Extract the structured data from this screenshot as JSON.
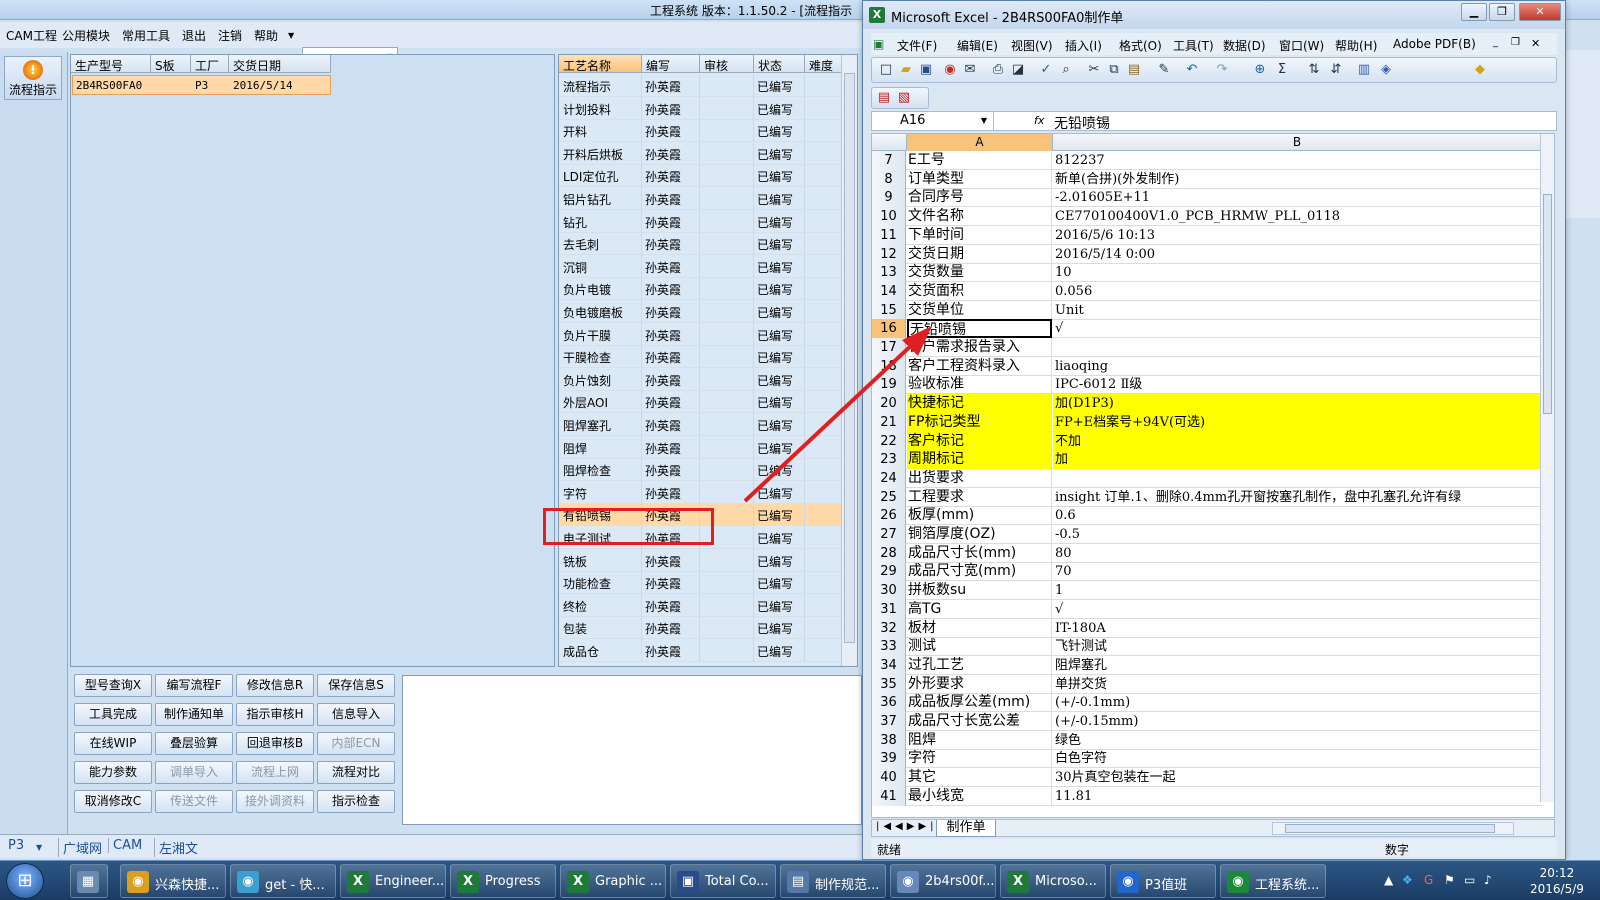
{
  "app": {
    "title": "工程系统   版本：1.1.50.2 - [流程指示",
    "menu": [
      "CAM工程",
      "公用模块",
      "常用工具",
      "退出",
      "注销",
      "帮助"
    ],
    "flow_button": "流程指示",
    "model_table": {
      "headers": [
        "生产型号",
        "S板",
        "工厂",
        "交货日期"
      ],
      "row": [
        "2B4RS00FA0",
        "",
        "P3",
        "2016/5/14"
      ]
    },
    "process_table": {
      "headers": [
        "工艺名称",
        "编写",
        "审核",
        "状态",
        "难度"
      ],
      "rows": [
        [
          "流程指示",
          "孙英霞",
          "",
          "已编写"
        ],
        [
          "计划投料",
          "孙英霞",
          "",
          "已编写"
        ],
        [
          "开料",
          "孙英霞",
          "",
          "已编写"
        ],
        [
          "开料后烘板",
          "孙英霞",
          "",
          "已编写"
        ],
        [
          "LDI定位孔",
          "孙英霞",
          "",
          "已编写"
        ],
        [
          "铝片钻孔",
          "孙英霞",
          "",
          "已编写"
        ],
        [
          "钻孔",
          "孙英霞",
          "",
          "已编写"
        ],
        [
          "去毛刺",
          "孙英霞",
          "",
          "已编写"
        ],
        [
          "沉铜",
          "孙英霞",
          "",
          "已编写"
        ],
        [
          "负片电镀",
          "孙英霞",
          "",
          "已编写"
        ],
        [
          "负电镀磨板",
          "孙英霞",
          "",
          "已编写"
        ],
        [
          "负片干膜",
          "孙英霞",
          "",
          "已编写"
        ],
        [
          "干膜检查",
          "孙英霞",
          "",
          "已编写"
        ],
        [
          "负片蚀刻",
          "孙英霞",
          "",
          "已编写"
        ],
        [
          "外层AOI",
          "孙英霞",
          "",
          "已编写"
        ],
        [
          "阻焊塞孔",
          "孙英霞",
          "",
          "已编写"
        ],
        [
          "阻焊",
          "孙英霞",
          "",
          "已编写"
        ],
        [
          "阻焊检查",
          "孙英霞",
          "",
          "已编写"
        ],
        [
          "字符",
          "孙英霞",
          "",
          "已编写"
        ],
        [
          "有铅喷锡",
          "孙英霞",
          "",
          "已编写"
        ],
        [
          "电子测试",
          "孙英霞",
          "",
          "已编写"
        ],
        [
          "铣板",
          "孙英霞",
          "",
          "已编写"
        ],
        [
          "功能检查",
          "孙英霞",
          "",
          "已编写"
        ],
        [
          "终检",
          "孙英霞",
          "",
          "已编写"
        ],
        [
          "包装",
          "孙英霞",
          "",
          "已编写"
        ],
        [
          "成品仓",
          "孙英霞",
          "",
          "已编写"
        ]
      ],
      "selected_index": 19
    },
    "buttons": [
      [
        "型号查询X",
        "编写流程F",
        "修改信息R",
        "保存信息S"
      ],
      [
        "工具完成",
        "制作通知单",
        "指示审核H",
        "信息导入"
      ],
      [
        "在线WIP",
        "叠层验算",
        "回退审核B",
        "内部ECN"
      ],
      [
        "能力参数",
        "调单导入",
        "流程上网",
        "流程对比"
      ],
      [
        "取消修改C",
        "传送文件",
        "接外调资料",
        "指示检查"
      ]
    ],
    "disabled_buttons": [
      "内部ECN",
      "调单导入",
      "流程上网",
      "传送文件",
      "接外调资料"
    ],
    "status_bar": [
      "P3",
      "广域网",
      "CAM",
      "左湘文"
    ]
  },
  "excel": {
    "title": "Microsoft Excel - 2B4RS00FA0制作单",
    "menu": [
      "文件(F)",
      "编辑(E)",
      "视图(V)",
      "插入(I)",
      "格式(O)",
      "工具(T)",
      "数据(D)",
      "窗口(W)",
      "帮助(H)",
      "Adobe PDF(B)"
    ],
    "name_box": "A16",
    "formula": "无铅喷锡",
    "columns": [
      "A",
      "B"
    ],
    "rows": [
      {
        "n": "7",
        "a": "E工号",
        "b": "812237"
      },
      {
        "n": "8",
        "a": "订单类型",
        "b": "新单(合拼)(外发制作)"
      },
      {
        "n": "9",
        "a": "合同序号",
        "b": "-2.01605E+11"
      },
      {
        "n": "10",
        "a": "文件名称",
        "b": "CE770100400V1.0_PCB_HRMW_PLL_0118"
      },
      {
        "n": "11",
        "a": "下单时间",
        "b": "2016/5/6 10:13"
      },
      {
        "n": "12",
        "a": "交货日期",
        "b": "2016/5/14 0:00"
      },
      {
        "n": "13",
        "a": "交货数量",
        "b": "10"
      },
      {
        "n": "14",
        "a": "交货面积",
        "b": "0.056"
      },
      {
        "n": "15",
        "a": "交货单位",
        "b": "Unit"
      },
      {
        "n": "16",
        "a": "无铅喷锡",
        "b": "√"
      },
      {
        "n": "17",
        "a": "客户需求报告录入",
        "b": ""
      },
      {
        "n": "18",
        "a": "客户工程资料录入",
        "b": "liaoqing"
      },
      {
        "n": "19",
        "a": "验收标准",
        "b": "IPC-6012 Ⅱ级"
      },
      {
        "n": "20",
        "a": "快捷标记",
        "b": "加(D1P3)"
      },
      {
        "n": "21",
        "a": "FP标记类型",
        "b": "FP+E档案号+94V(可选)"
      },
      {
        "n": "22",
        "a": "客户标记",
        "b": "不加"
      },
      {
        "n": "23",
        "a": "周期标记",
        "b": "加"
      },
      {
        "n": "24",
        "a": "出货要求",
        "b": ""
      },
      {
        "n": "25",
        "a": "工程要求",
        "b": "insight 订单.1、删除0.4mm孔开窗按塞孔制作，盘中孔塞孔允许有绿"
      },
      {
        "n": "26",
        "a": "板厚(mm)",
        "b": "0.6"
      },
      {
        "n": "27",
        "a": "铜箔厚度(OZ)",
        "b": "-0.5"
      },
      {
        "n": "28",
        "a": "成品尺寸长(mm)",
        "b": "80"
      },
      {
        "n": "29",
        "a": "成品尺寸宽(mm)",
        "b": "70"
      },
      {
        "n": "30",
        "a": "拼板数su",
        "b": "1"
      },
      {
        "n": "31",
        "a": "高TG",
        "b": "√"
      },
      {
        "n": "32",
        "a": "板材",
        "b": "IT-180A"
      },
      {
        "n": "33",
        "a": "测试",
        "b": "飞针测试"
      },
      {
        "n": "34",
        "a": "过孔工艺",
        "b": "阻焊塞孔"
      },
      {
        "n": "35",
        "a": "外形要求",
        "b": "单拼交货"
      },
      {
        "n": "36",
        "a": "成品板厚公差(mm)",
        "b": "(+/-0.1mm)"
      },
      {
        "n": "37",
        "a": "成品尺寸长宽公差",
        "b": "(+/-0.15mm)"
      },
      {
        "n": "38",
        "a": "阻焊",
        "b": "绿色"
      },
      {
        "n": "39",
        "a": "字符",
        "b": "白色字符"
      },
      {
        "n": "40",
        "a": "其它",
        "b": "30片真空包装在一起"
      },
      {
        "n": "41",
        "a": "最小线宽",
        "b": "11.81"
      }
    ],
    "yellow_rows": [
      "20",
      "21",
      "22",
      "23"
    ],
    "active_row": "16",
    "sheet_tab": "制作单",
    "status_left": "就绪",
    "status_right": "数字"
  },
  "taskbar": {
    "items": [
      {
        "label": "兴森快捷...",
        "icon": "flower-icon",
        "color": "#d9a020"
      },
      {
        "label": "get - 快...",
        "icon": "eye-icon",
        "color": "#3aa0d0"
      },
      {
        "label": "Engineer...",
        "icon": "excel-icon",
        "color": "#1f7a3a"
      },
      {
        "label": "Progress",
        "icon": "excel-icon",
        "color": "#1f7a3a"
      },
      {
        "label": "Graphic ...",
        "icon": "excel-icon",
        "color": "#1f7a3a"
      },
      {
        "label": "Total Co...",
        "icon": "floppy-icon",
        "color": "#2a4a8a"
      },
      {
        "label": "制作规范...",
        "icon": "document-icon",
        "color": "#5577aa"
      },
      {
        "label": "2b4rs00f...",
        "icon": "image-icon",
        "color": "#6688bb"
      },
      {
        "label": "Microso...",
        "icon": "excel-icon",
        "color": "#1f7a3a"
      },
      {
        "label": "P3值班",
        "icon": "app-icon",
        "color": "#2266cc"
      },
      {
        "label": "工程系统...",
        "icon": "app-icon",
        "color": "#1a8a3a"
      }
    ],
    "time": "20:12",
    "date": "2016/5/9"
  },
  "colors": {
    "highlight_red": "#e02020",
    "selected_row": "#ffd9a8",
    "yellow_fill": "#ffff00"
  }
}
